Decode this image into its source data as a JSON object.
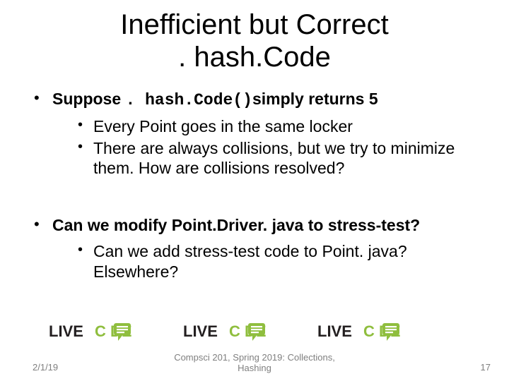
{
  "title_line1": "Inefficient but Correct",
  "title_line2": ". hash.Code",
  "bullets": {
    "b1_prefix": "Suppose ",
    "b1_mono": ". hash.Code()",
    "b1_suffix": "simply returns 5",
    "b1_sub": [
      "Every Point goes in the same locker",
      "There are always collisions, but we try to minimize them. How are collisions resolved?"
    ],
    "b2_text": "Can we modify Point.Driver. java to stress-test?",
    "b2_sub": [
      "Can we add stress-test code to Point. java? Elsewhere?"
    ]
  },
  "logo": {
    "live_color": "#231f20",
    "code_color": "#8fbe3e",
    "live_text": "LIVE",
    "code_text": "C   DE"
  },
  "footer": {
    "date": "2/1/19",
    "mid": "Compsci 201, Spring 2019: Collections, Hashing",
    "page": "17"
  }
}
